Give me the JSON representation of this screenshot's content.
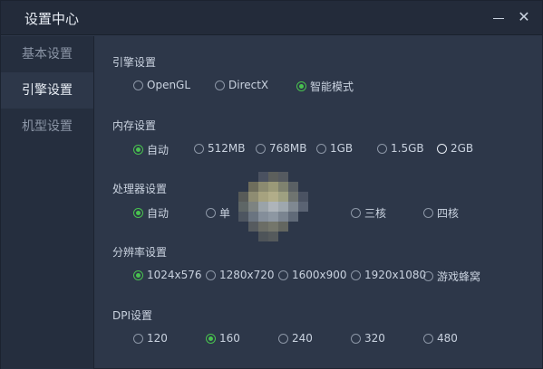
{
  "window": {
    "title": "设置中心",
    "minimize_icon": "minimize-icon",
    "close_icon": "close-icon",
    "close_glyph": "✕"
  },
  "sidebar": {
    "items": [
      {
        "label": "基本设置",
        "active": false
      },
      {
        "label": "引擎设置",
        "active": true
      },
      {
        "label": "机型设置",
        "active": false
      }
    ]
  },
  "sections": {
    "engine": {
      "title": "引擎设置",
      "options": [
        {
          "label": "OpenGL",
          "selected": false
        },
        {
          "label": "DirectX",
          "selected": false
        },
        {
          "label": "智能模式",
          "selected": true
        }
      ]
    },
    "memory": {
      "title": "内存设置",
      "options": [
        {
          "label": "自动",
          "selected": true
        },
        {
          "label": "512MB",
          "selected": false
        },
        {
          "label": "768MB",
          "selected": false
        },
        {
          "label": "1GB",
          "selected": false
        },
        {
          "label": "1.5GB",
          "selected": false
        },
        {
          "label": "2GB",
          "selected": false,
          "highlight": true
        }
      ]
    },
    "cpu": {
      "title": "处理器设置",
      "options": [
        {
          "label": "自动",
          "selected": true
        },
        {
          "label": "单",
          "selected": false
        },
        {
          "label": "三核",
          "selected": false
        },
        {
          "label": "四核",
          "selected": false
        }
      ]
    },
    "resolution": {
      "title": "分辨率设置",
      "options": [
        {
          "label": "1024x576",
          "selected": true
        },
        {
          "label": "1280x720",
          "selected": false
        },
        {
          "label": "1600x900",
          "selected": false
        },
        {
          "label": "1920x1080",
          "selected": false
        },
        {
          "label": "游戏蜂窝",
          "selected": false
        }
      ]
    },
    "dpi": {
      "title": "DPI设置",
      "options": [
        {
          "label": "120",
          "selected": false
        },
        {
          "label": "160",
          "selected": true
        },
        {
          "label": "240",
          "selected": false
        },
        {
          "label": "320",
          "selected": false
        },
        {
          "label": "480",
          "selected": false
        }
      ]
    }
  },
  "colors": {
    "accent": "#49c24f",
    "background": "#2d3749",
    "sidebar": "#252e3e",
    "titlebar": "#232b3a"
  }
}
